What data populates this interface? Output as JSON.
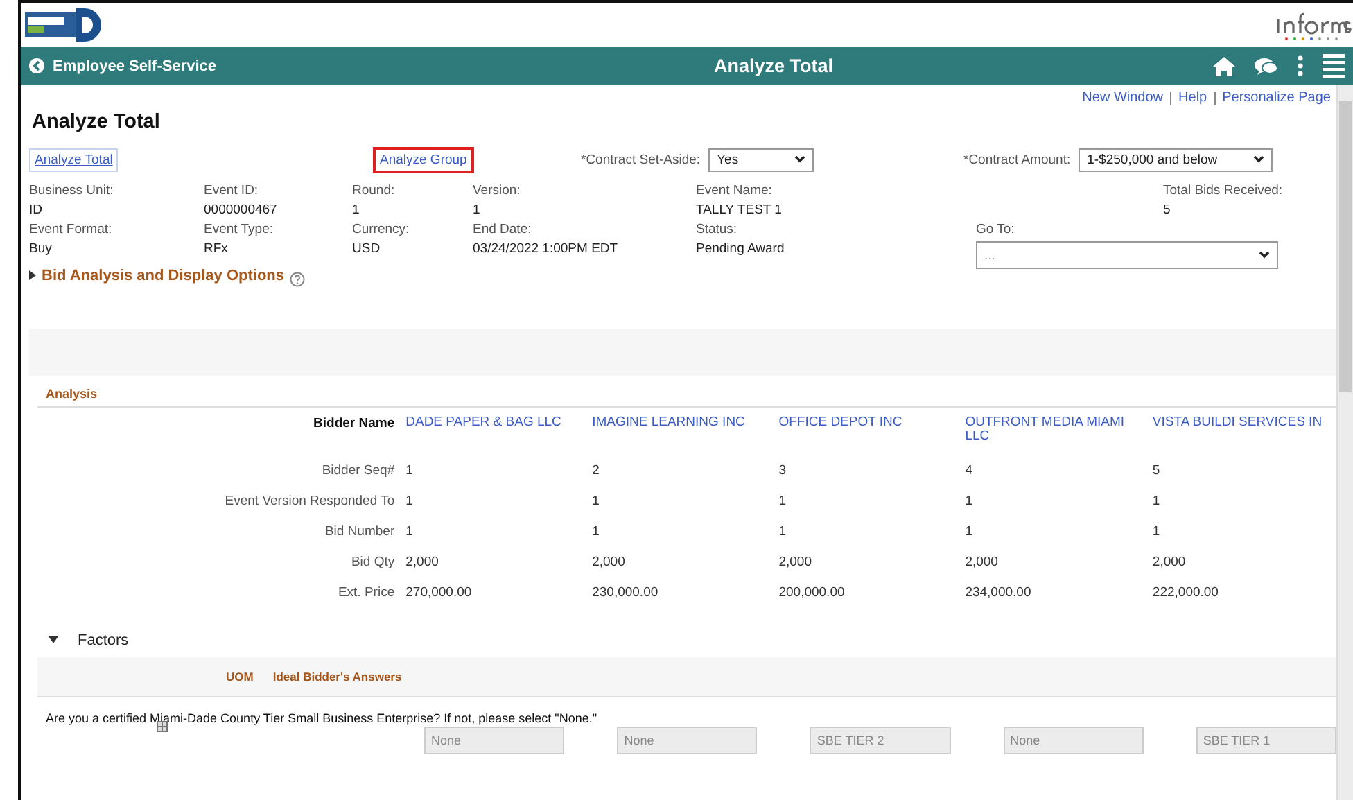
{
  "nav_bar": {
    "back_label": "Employee Self-Service",
    "title": "Analyze Total"
  },
  "top_links": [
    "New Window",
    "Help",
    "Personalize Page"
  ],
  "page_title": "Analyze Total",
  "view_links": [
    {
      "label": "Analyze Total",
      "selected": true
    },
    {
      "label": "Analyze Group",
      "selected": false
    }
  ],
  "contract_set_aside": {
    "label": "*Contract Set-Aside:",
    "value": "Yes"
  },
  "contract_amount": {
    "label": "*Contract Amount:",
    "value": "1-$250,000 and below"
  },
  "summary_row_1": [
    {
      "label": "Business Unit:",
      "value": "ID"
    },
    {
      "label": "Event ID:",
      "value": "0000000467"
    },
    {
      "label": "Round:",
      "value": "1"
    },
    {
      "label": "Version:",
      "value": "1"
    },
    {
      "label": "Event Name:",
      "value": "TALLY TEST 1"
    },
    {
      "label": "Total Bids Received:",
      "value": "5"
    }
  ],
  "summary_row_2": [
    {
      "label": "Event Format:",
      "value": "Buy"
    },
    {
      "label": "Event Type:",
      "value": "RFx"
    },
    {
      "label": "Currency:",
      "value": "USD"
    },
    {
      "label": "End Date:",
      "value": "03/24/2022  1:00PM EDT"
    },
    {
      "label": "Status:",
      "value": "Pending Award"
    }
  ],
  "go_to": {
    "label": "Go To:",
    "value": "..."
  },
  "options_section": {
    "label": "Bid Analysis and Display Options",
    "expanded": false
  },
  "analysis": {
    "title": "Analysis",
    "header_label": "Bidder Name",
    "bidders": [
      "DADE PAPER & BAG LLC",
      "IMAGINE LEARNING INC",
      "OFFICE DEPOT INC",
      "OUTFRONT MEDIA MIAMI LLC",
      "VISTA BUILDI SERVICES IN"
    ],
    "rows": [
      {
        "label": "Bidder Seq#",
        "values": [
          "1",
          "2",
          "3",
          "4",
          "5"
        ]
      },
      {
        "label": "Event Version Responded To",
        "values": [
          "1",
          "1",
          "1",
          "1",
          "1"
        ]
      },
      {
        "label": "Bid Number",
        "values": [
          "1",
          "1",
          "1",
          "1",
          "1"
        ]
      },
      {
        "label": "Bid Qty",
        "values": [
          "2,000",
          "2,000",
          "2,000",
          "2,000",
          "2,000"
        ]
      },
      {
        "label": "Ext. Price",
        "values": [
          "270,000.00",
          "230,000.00",
          "200,000.00",
          "234,000.00",
          "222,000.00"
        ]
      }
    ]
  },
  "factors": {
    "title": "Factors",
    "expanded": true,
    "columns": [
      "UOM",
      "Ideal Bidder's Answers"
    ],
    "question": "Are you a certified Miami-Dade County Tier Small Business Enterprise? If not, please select \"None.\"",
    "answers": [
      "None",
      "None",
      "SBE TIER 2",
      "None",
      "SBE TIER 1"
    ]
  }
}
